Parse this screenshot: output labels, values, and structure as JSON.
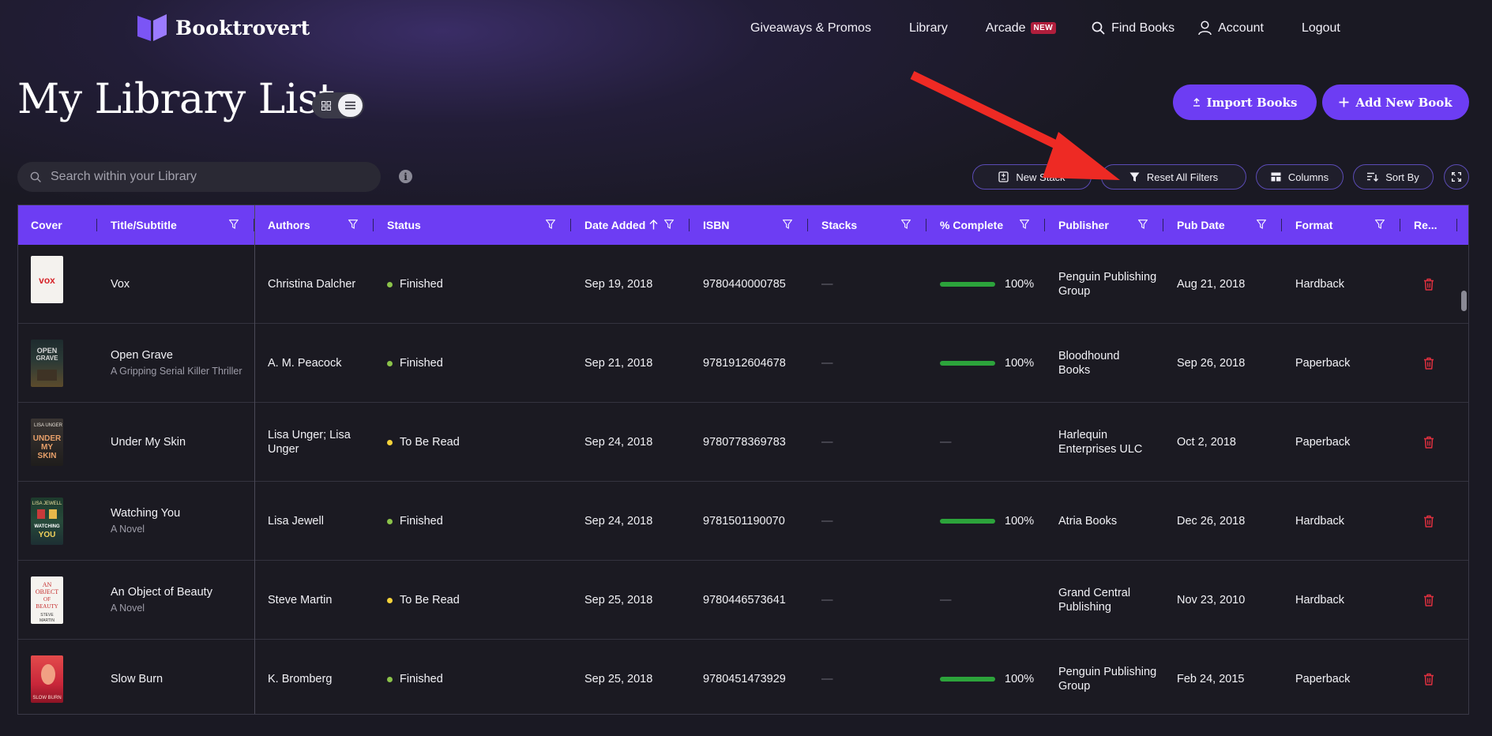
{
  "brand": {
    "name": "Booktrovert"
  },
  "nav": {
    "giveaways": "Giveaways & Promos",
    "library": "Library",
    "arcade": "Arcade",
    "arcade_badge": "NEW",
    "find_books": "Find Books",
    "account": "Account",
    "logout": "Logout"
  },
  "page": {
    "title": "My Library List",
    "import_label": "Import Books",
    "add_label": "Add New Book"
  },
  "search": {
    "placeholder": "Search within your Library",
    "value": ""
  },
  "toolbar": {
    "new_stack": "New Stack",
    "reset_filters": "Reset All Filters",
    "columns": "Columns",
    "sort_by": "Sort By"
  },
  "table": {
    "headers": {
      "cover": "Cover",
      "title": "Title/Subtitle",
      "authors": "Authors",
      "status": "Status",
      "date_added": "Date Added",
      "isbn": "ISBN",
      "stacks": "Stacks",
      "complete": "% Complete",
      "publisher": "Publisher",
      "pub_date": "Pub Date",
      "format": "Format",
      "remove": "Re..."
    },
    "rows": [
      {
        "title": "Vox",
        "subtitle": "",
        "authors": "Christina Dalcher",
        "status": "Finished",
        "date_added": "Sep 19, 2018",
        "isbn": "9780440000785",
        "stacks": "—",
        "complete": "100%",
        "publisher": "Penguin Publishing Group",
        "pub_date": "Aug 21, 2018",
        "format": "Hardback"
      },
      {
        "title": "Open Grave",
        "subtitle": "A Gripping Serial Killer Thriller",
        "authors": "A. M. Peacock",
        "status": "Finished",
        "date_added": "Sep 21, 2018",
        "isbn": "9781912604678",
        "stacks": "—",
        "complete": "100%",
        "publisher": "Bloodhound Books",
        "pub_date": "Sep 26, 2018",
        "format": "Paperback"
      },
      {
        "title": "Under My Skin",
        "subtitle": "",
        "authors": "Lisa Unger; Lisa Unger",
        "status": "To Be Read",
        "date_added": "Sep 24, 2018",
        "isbn": "9780778369783",
        "stacks": "—",
        "complete": "—",
        "publisher": "Harlequin Enterprises ULC",
        "pub_date": "Oct 2, 2018",
        "format": "Paperback"
      },
      {
        "title": "Watching You",
        "subtitle": "A Novel",
        "authors": "Lisa Jewell",
        "status": "Finished",
        "date_added": "Sep 24, 2018",
        "isbn": "9781501190070",
        "stacks": "—",
        "complete": "100%",
        "publisher": "Atria Books",
        "pub_date": "Dec 26, 2018",
        "format": "Hardback"
      },
      {
        "title": "An Object of Beauty",
        "subtitle": "A Novel",
        "authors": "Steve Martin",
        "status": "To Be Read",
        "date_added": "Sep 25, 2018",
        "isbn": "9780446573641",
        "stacks": "—",
        "complete": "—",
        "publisher": "Grand Central Publishing",
        "pub_date": "Nov 23, 2010",
        "format": "Hardback"
      },
      {
        "title": "Slow Burn",
        "subtitle": "",
        "authors": "K. Bromberg",
        "status": "Finished",
        "date_added": "Sep 25, 2018",
        "isbn": "9780451473929",
        "stacks": "—",
        "complete": "100%",
        "publisher": "Penguin Publishing Group",
        "pub_date": "Feb 24, 2015",
        "format": "Paperback"
      }
    ]
  },
  "colors": {
    "accent": "#6d3df3",
    "finished": "#8bc34a",
    "to_be_read": "#f5d33a",
    "progress": "#2ca33b",
    "delete": "#e0303f",
    "annotation_arrow": "#ee2a24"
  }
}
